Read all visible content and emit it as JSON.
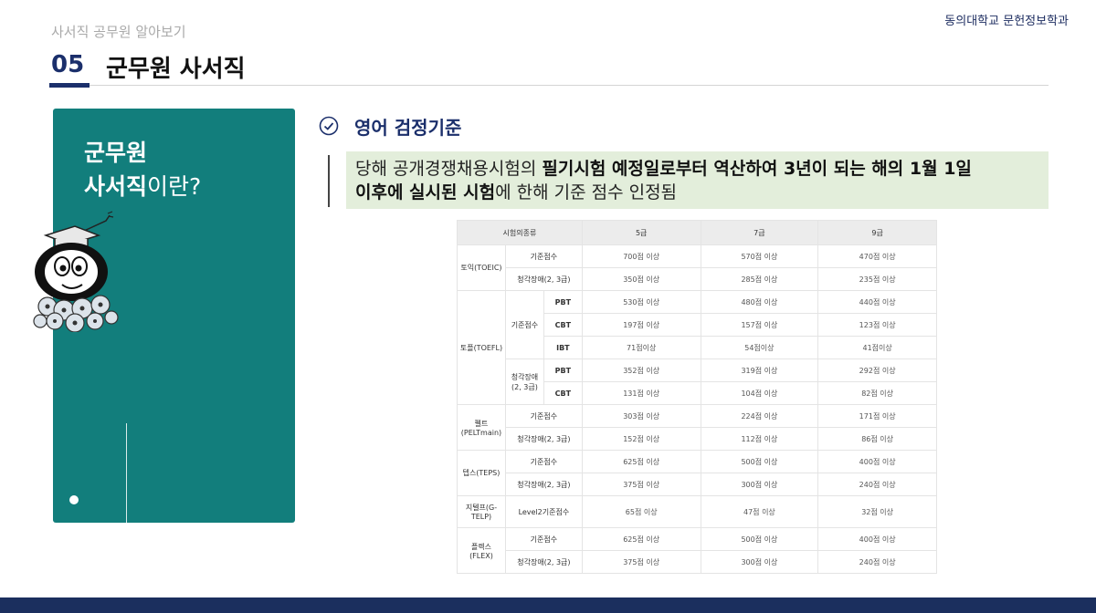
{
  "org": "동의대학교 문헌정보학과",
  "subtitle": "사서직 공무원 알아보기",
  "section": {
    "number": "05",
    "title": "군무원 사서직"
  },
  "panel": {
    "line1": "군무원",
    "line2_bold": "사서직",
    "line2_rest": "이란?"
  },
  "english": {
    "title": "영어 검정기준",
    "note_p1": "당해 공개경쟁채용시험의 ",
    "note_b1": "필기시험 예정일로부터 역산하여 3년이 되는 해의 1월 1일",
    "note_b2": "이후에 실시된 시험",
    "note_p2": "에 한해 기준 점수 인정됨"
  },
  "table": {
    "headers": [
      "시험의종류",
      "5급",
      "7급",
      "9급"
    ],
    "toeic": {
      "name": "토익(TOEIC)",
      "rows": [
        {
          "label": "기준점수",
          "v": [
            "700점 이상",
            "570점 이상",
            "470점 이상"
          ]
        },
        {
          "label": "청각장애(2, 3급)",
          "v": [
            "350점 이상",
            "285점 이상",
            "235점 이상"
          ]
        }
      ]
    },
    "toefl": {
      "name": "토플(TOEFL)",
      "base_label": "기준점수",
      "hear_label": "청각장애\n(2, 3급)",
      "base": [
        {
          "sub": "PBT",
          "v": [
            "530점 이상",
            "480점 이상",
            "440점 이상"
          ]
        },
        {
          "sub": "CBT",
          "v": [
            "197점 이상",
            "157점 이상",
            "123점 이상"
          ]
        },
        {
          "sub": "IBT",
          "v": [
            "71점이상",
            "54점이상",
            "41점이상"
          ]
        }
      ],
      "hear": [
        {
          "sub": "PBT",
          "v": [
            "352점 이상",
            "319점 이상",
            "292점 이상"
          ]
        },
        {
          "sub": "CBT",
          "v": [
            "131점 이상",
            "104점 이상",
            "82점 이상"
          ]
        }
      ]
    },
    "pelt": {
      "name": "펠트\n(PELTmain)",
      "rows": [
        {
          "label": "기준점수",
          "v": [
            "303점 이상",
            "224점 이상",
            "171점 이상"
          ]
        },
        {
          "label": "청각장애(2, 3급)",
          "v": [
            "152점 이상",
            "112점 이상",
            "86점 이상"
          ]
        }
      ]
    },
    "teps": {
      "name": "텝스(TEPS)",
      "rows": [
        {
          "label": "기준점수",
          "v": [
            "625점 이상",
            "500점 이상",
            "400점 이상"
          ]
        },
        {
          "label": "청각장애(2, 3급)",
          "v": [
            "375점 이상",
            "300점 이상",
            "240점 이상"
          ]
        }
      ]
    },
    "gtelp": {
      "name": "지텔프(G-\nTELP)",
      "label": "Level2기준점수",
      "v": [
        "65점 이상",
        "47점 이상",
        "32점 이상"
      ]
    },
    "flex": {
      "name": "플렉스\n(FLEX)",
      "rows": [
        {
          "label": "기준점수",
          "v": [
            "625점 이상",
            "500점 이상",
            "400점 이상"
          ]
        },
        {
          "label": "청각장애(2, 3급)",
          "v": [
            "375점 이상",
            "300점 이상",
            "240점 이상"
          ]
        }
      ]
    }
  },
  "colors": {
    "navy": "#1b2f6b",
    "teal": "#127e7c",
    "note_bg": "#e3eedb"
  }
}
